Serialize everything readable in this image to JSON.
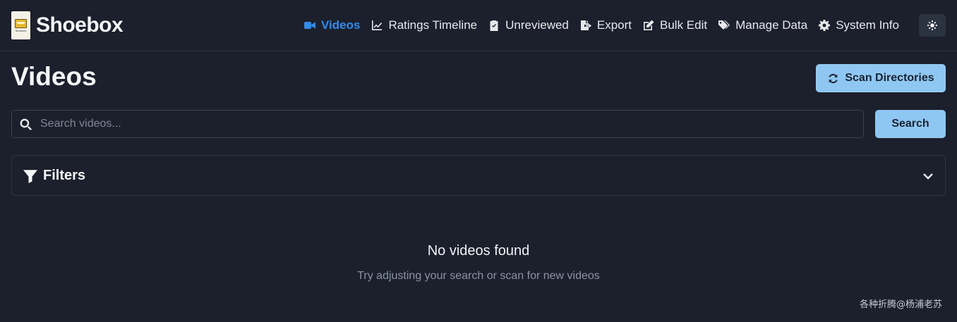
{
  "app": {
    "name": "Shoebox",
    "logo_text": "Shoebox"
  },
  "nav": {
    "items": [
      {
        "label": "Videos",
        "icon": "video-camera-icon",
        "active": true
      },
      {
        "label": "Ratings Timeline",
        "icon": "line-chart-icon",
        "active": false
      },
      {
        "label": "Unreviewed",
        "icon": "clipboard-check-icon",
        "active": false
      },
      {
        "label": "Export",
        "icon": "file-export-icon",
        "active": false
      },
      {
        "label": "Bulk Edit",
        "icon": "edit-icon",
        "active": false
      },
      {
        "label": "Manage Data",
        "icon": "tags-icon",
        "active": false
      },
      {
        "label": "System Info",
        "icon": "gear-icon",
        "active": false
      }
    ],
    "theme_toggle_icon": "sun-icon"
  },
  "page": {
    "title": "Videos",
    "scan_button": "Scan Directories"
  },
  "search": {
    "placeholder": "Search videos...",
    "value": "",
    "button": "Search"
  },
  "filters": {
    "title": "Filters"
  },
  "empty_state": {
    "title": "No videos found",
    "subtitle": "Try adjusting your search or scan for new videos"
  },
  "watermark": "各种折腾@杨浦老苏",
  "colors": {
    "background": "#1b202c",
    "accent": "#2f8df0",
    "button": "#8ec8f2"
  }
}
